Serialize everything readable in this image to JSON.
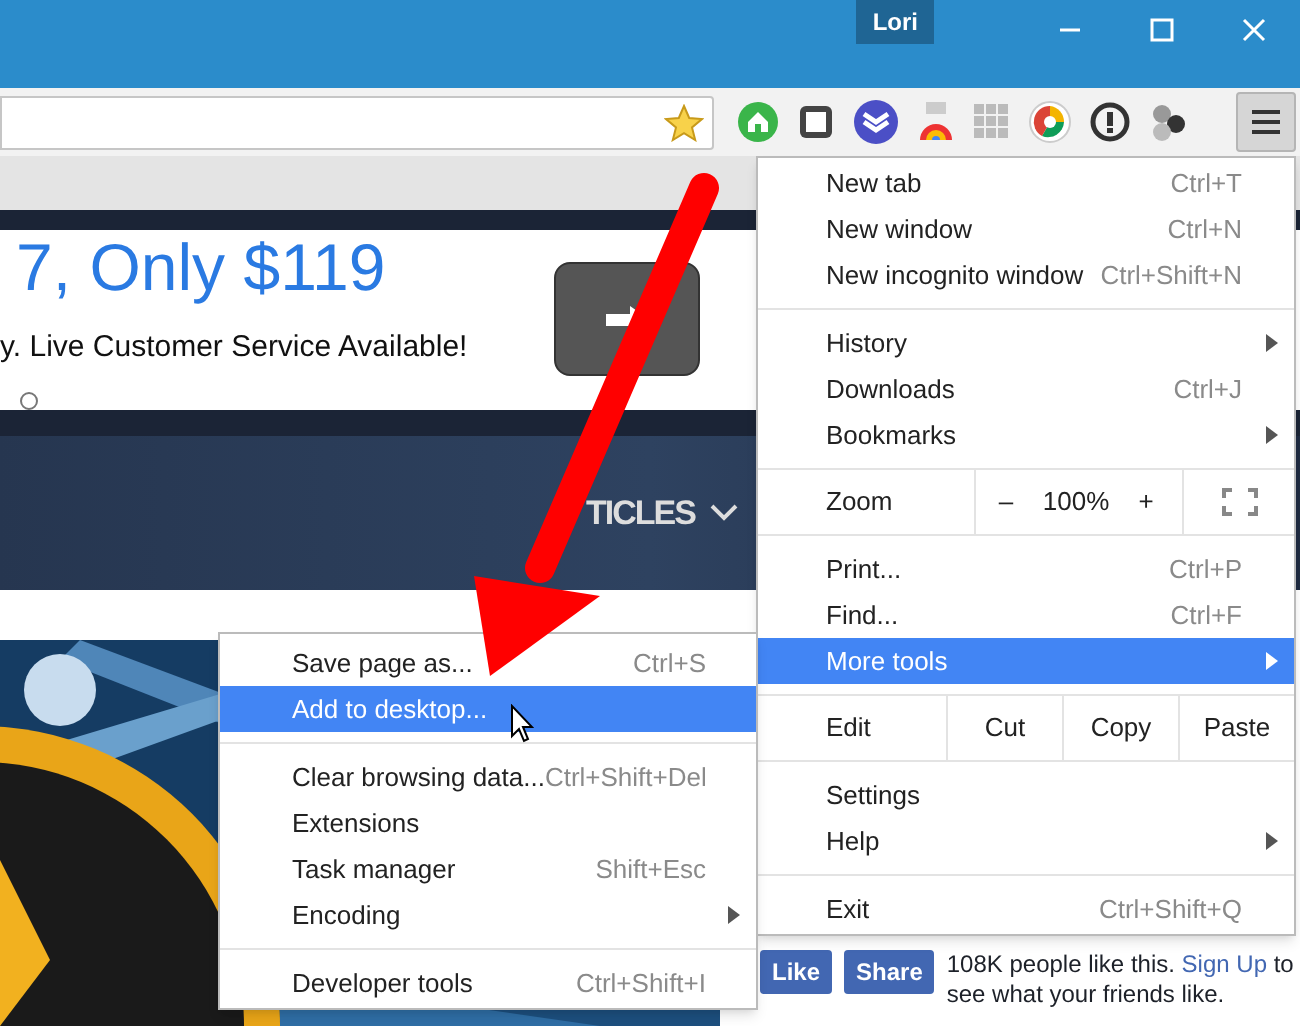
{
  "window": {
    "user": "Lori"
  },
  "page": {
    "headline": "7, Only $119",
    "subline": "y. Live Customer Service Available!",
    "nav_label": "TICLES",
    "social": {
      "like": "Like",
      "share": "Share",
      "text_before": "108K people like this.",
      "link": "Sign Up",
      "text_after": "to see what your friends like."
    }
  },
  "menu": [
    {
      "kind": "item",
      "label": "New tab",
      "shortcut": "Ctrl+T",
      "submenu": false,
      "selected": false
    },
    {
      "kind": "item",
      "label": "New window",
      "shortcut": "Ctrl+N",
      "submenu": false,
      "selected": false
    },
    {
      "kind": "item",
      "label": "New incognito window",
      "shortcut": "Ctrl+Shift+N",
      "submenu": false,
      "selected": false
    },
    {
      "kind": "separator"
    },
    {
      "kind": "item",
      "label": "History",
      "submenu": true,
      "selected": false
    },
    {
      "kind": "item",
      "label": "Downloads",
      "shortcut": "Ctrl+J",
      "submenu": false,
      "selected": false
    },
    {
      "kind": "item",
      "label": "Bookmarks",
      "submenu": true,
      "selected": false
    },
    {
      "kind": "zoom",
      "label": "Zoom",
      "minus": "–",
      "value": "100%",
      "plus": "+"
    },
    {
      "kind": "item",
      "label": "Print...",
      "shortcut": "Ctrl+P",
      "submenu": false,
      "selected": false
    },
    {
      "kind": "item",
      "label": "Find...",
      "shortcut": "Ctrl+F",
      "submenu": false,
      "selected": false
    },
    {
      "kind": "item",
      "label": "More tools",
      "submenu": true,
      "selected": true
    },
    {
      "kind": "edit",
      "label": "Edit",
      "buttons": [
        "Cut",
        "Copy",
        "Paste"
      ]
    },
    {
      "kind": "item",
      "label": "Settings",
      "submenu": false,
      "selected": false
    },
    {
      "kind": "item",
      "label": "Help",
      "submenu": true,
      "selected": false
    },
    {
      "kind": "separator"
    },
    {
      "kind": "item",
      "label": "Exit",
      "shortcut": "Ctrl+Shift+Q",
      "submenu": false,
      "selected": false
    }
  ],
  "submenu": [
    {
      "kind": "item",
      "label": "Save page as...",
      "shortcut": "Ctrl+S",
      "submenu": false,
      "selected": false
    },
    {
      "kind": "item",
      "label": "Add to desktop...",
      "submenu": false,
      "selected": true
    },
    {
      "kind": "separator"
    },
    {
      "kind": "item",
      "label": "Clear browsing data...",
      "shortcut": "Ctrl+Shift+Del",
      "submenu": false,
      "selected": false
    },
    {
      "kind": "item",
      "label": "Extensions",
      "submenu": false,
      "selected": false
    },
    {
      "kind": "item",
      "label": "Task manager",
      "shortcut": "Shift+Esc",
      "submenu": false,
      "selected": false
    },
    {
      "kind": "item",
      "label": "Encoding",
      "submenu": true,
      "selected": false
    },
    {
      "kind": "separator"
    },
    {
      "kind": "item",
      "label": "Developer tools",
      "shortcut": "Ctrl+Shift+I",
      "submenu": false,
      "selected": false
    }
  ]
}
